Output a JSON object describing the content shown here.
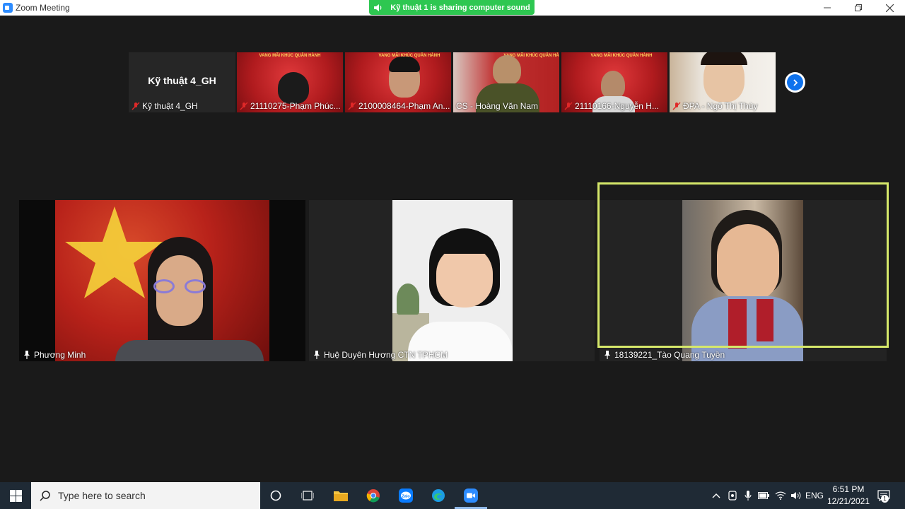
{
  "window": {
    "title": "Zoom Meeting"
  },
  "share_banner": {
    "text": "Kỹ thuật 1 is sharing computer sound"
  },
  "strip": {
    "host_tile": {
      "title": "Kỹ thuật 4_GH",
      "label": "Kỹ thuật 4_GH"
    },
    "participants": [
      {
        "label": "21110275-Phạm Phúc..."
      },
      {
        "label": "2100008464-Phạm An..."
      },
      {
        "label": "CS - Hoàng Văn Nam"
      },
      {
        "label": "21110166-Nguyễn H..."
      },
      {
        "label": "ĐPA - Ngô Thị Thùy"
      }
    ],
    "banner_text": "VANG MÃI KHÚC QUÂN HÀNH"
  },
  "gallery": [
    {
      "label": "Phương Minh"
    },
    {
      "label": "Huệ Duyên Hương CTN TPHCM"
    },
    {
      "label": "18139221_Tào Quang Tuyền",
      "active_speaker": true
    }
  ],
  "taskbar": {
    "search_placeholder": "Type here to search",
    "language": "ENG",
    "time": "6:51 PM",
    "date": "12/21/2021",
    "notification_count": "1"
  },
  "colors": {
    "zoom_blue": "#2d8cff",
    "share_green": "#2ec751",
    "active_speaker_border": "#d6e86a",
    "taskbar_bg": "#1f2a35"
  }
}
